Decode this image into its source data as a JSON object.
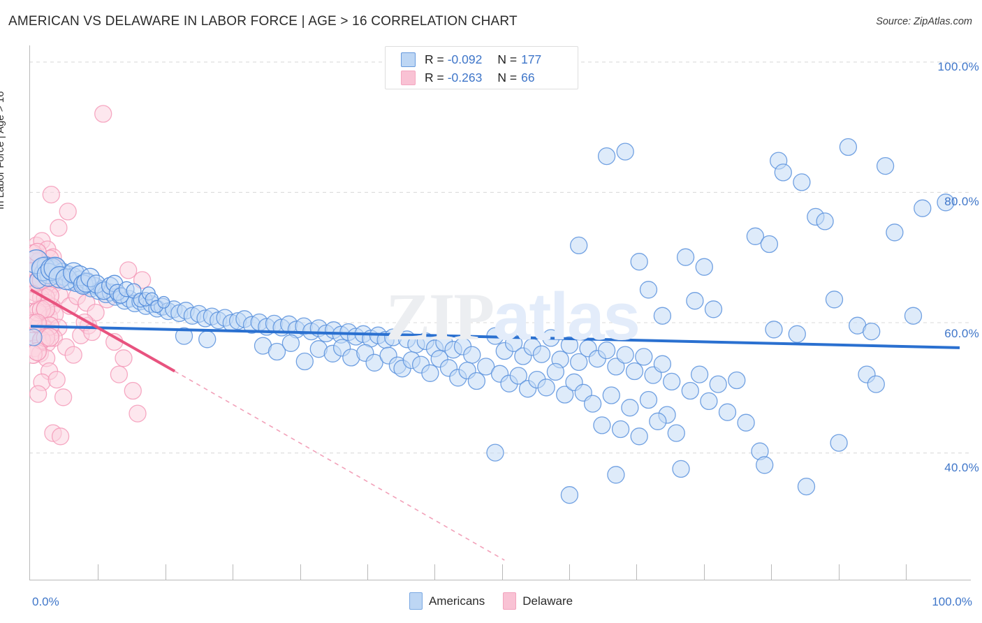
{
  "header": {
    "title": "AMERICAN VS DELAWARE IN LABOR FORCE | AGE > 16 CORRELATION CHART",
    "source": "Source: ZipAtlas.com"
  },
  "watermark": {
    "part1": "ZIP",
    "part2": "atlas"
  },
  "legend_box": {
    "rows": [
      {
        "series": "Americans",
        "r_label": "R =",
        "r_value": "-0.092",
        "n_label": "N =",
        "n_value": "177",
        "color": "#bdd6f4"
      },
      {
        "series": "Delaware",
        "r_label": "R =",
        "r_value": "-0.263",
        "n_label": "N =",
        "n_value": "66",
        "color": "#f9c2d4"
      }
    ]
  },
  "bottom_legend": [
    {
      "label": "Americans",
      "color": "#bdd6f4"
    },
    {
      "label": "Delaware",
      "color": "#f9c2d4"
    }
  ],
  "axes": {
    "y_title": "In Labor Force | Age > 16",
    "y_ticks": [
      "100.0%",
      "80.0%",
      "60.0%",
      "40.0%"
    ],
    "x_min_label": "0.0%",
    "x_max_label": "100.0%"
  },
  "chart_data": {
    "type": "scatter",
    "title": "AMERICAN VS DELAWARE IN LABOR FORCE | AGE > 16 CORRELATION CHART",
    "xlabel": "",
    "ylabel": "In Labor Force | Age > 16",
    "xlim": [
      0,
      100
    ],
    "ylim": [
      20.5,
      102.5
    ],
    "x_tick_values": [
      0,
      100
    ],
    "y_tick_values": [
      40,
      60,
      80,
      100
    ],
    "grid": "horizontal-dashed",
    "legend_position": "top-center",
    "colors": {
      "americans_fill": "#c3daf6",
      "americans_stroke": "#5b92dd",
      "delaware_fill": "#fbd3e0",
      "delaware_stroke": "#f49ab9",
      "trend_americans": "#2a70d0",
      "trend_delaware": "#e8537f"
    },
    "series": [
      {
        "name": "Americans",
        "r": -0.092,
        "n": 177,
        "trendline": {
          "x0": 0,
          "y0": 59.4,
          "x1": 100,
          "y1": 56.1,
          "style": "solid"
        },
        "points": [
          [
            0.3,
            57.7
          ],
          [
            0.8,
            66.5
          ],
          [
            1.0,
            68.4
          ],
          [
            1.3,
            67.6
          ],
          [
            1.6,
            68.8
          ],
          [
            1.9,
            67.2
          ],
          [
            2.2,
            68.3
          ],
          [
            2.5,
            67.5
          ],
          [
            2.8,
            68.6
          ],
          [
            3.1,
            67.0
          ],
          [
            3.4,
            67.8
          ],
          [
            3.7,
            66.9
          ],
          [
            4.0,
            67.4
          ],
          [
            4.3,
            66.2
          ],
          [
            4.6,
            67.1
          ],
          [
            4.9,
            66.0
          ],
          [
            5.3,
            66.6
          ],
          [
            5.7,
            65.8
          ],
          [
            6.1,
            66.3
          ],
          [
            6.5,
            65.2
          ],
          [
            6.9,
            65.6
          ],
          [
            7.3,
            64.8
          ],
          [
            7.7,
            65.1
          ],
          [
            8.1,
            64.3
          ],
          [
            8.6,
            64.6
          ],
          [
            9.1,
            63.9
          ],
          [
            9.6,
            64.1
          ],
          [
            10.1,
            63.3
          ],
          [
            10.6,
            63.6
          ],
          [
            11.2,
            62.9
          ],
          [
            11.8,
            63.2
          ],
          [
            12.4,
            62.5
          ],
          [
            13.0,
            62.8
          ],
          [
            13.6,
            62.1
          ],
          [
            14.2,
            62.4
          ],
          [
            14.8,
            61.7
          ],
          [
            15.4,
            62.0
          ],
          [
            16.0,
            61.4
          ],
          [
            16.7,
            61.8
          ],
          [
            17.4,
            61.0
          ],
          [
            18.1,
            61.3
          ],
          [
            18.8,
            60.6
          ],
          [
            19.5,
            60.9
          ],
          [
            20.2,
            60.3
          ],
          [
            20.9,
            60.7
          ],
          [
            21.6,
            59.9
          ],
          [
            22.3,
            60.2
          ],
          [
            16.5,
            57.9
          ],
          [
            19.0,
            57.4
          ],
          [
            23.0,
            60.5
          ],
          [
            23.8,
            59.6
          ],
          [
            24.6,
            60.0
          ],
          [
            25.4,
            59.3
          ],
          [
            26.2,
            59.8
          ],
          [
            27.0,
            59.2
          ],
          [
            27.8,
            59.7
          ],
          [
            28.6,
            58.9
          ],
          [
            29.4,
            59.4
          ],
          [
            30.2,
            58.6
          ],
          [
            31.0,
            59.1
          ],
          [
            31.8,
            58.3
          ],
          [
            32.6,
            58.8
          ],
          [
            33.4,
            58.1
          ],
          [
            34.2,
            58.5
          ],
          [
            35.0,
            57.8
          ],
          [
            35.8,
            58.2
          ],
          [
            36.6,
            57.5
          ],
          [
            37.4,
            58.0
          ],
          [
            38.2,
            57.3
          ],
          [
            39.0,
            57.7
          ],
          [
            25.0,
            56.4
          ],
          [
            26.5,
            55.5
          ],
          [
            28.0,
            56.8
          ],
          [
            29.5,
            54.0
          ],
          [
            31.0,
            55.9
          ],
          [
            32.5,
            55.2
          ],
          [
            33.5,
            56.1
          ],
          [
            34.5,
            54.6
          ],
          [
            36.0,
            55.3
          ],
          [
            37.0,
            53.8
          ],
          [
            38.5,
            54.9
          ],
          [
            39.5,
            53.4
          ],
          [
            40.5,
            57.4
          ],
          [
            41.5,
            56.6
          ],
          [
            42.5,
            57.1
          ],
          [
            43.5,
            56.0
          ],
          [
            44.5,
            56.9
          ],
          [
            45.5,
            55.8
          ],
          [
            46.5,
            56.3
          ],
          [
            47.5,
            55.0
          ],
          [
            40.0,
            52.9
          ],
          [
            41.0,
            54.2
          ],
          [
            42.0,
            53.5
          ],
          [
            43.0,
            52.2
          ],
          [
            44.0,
            54.4
          ],
          [
            45.0,
            53.0
          ],
          [
            46.0,
            51.5
          ],
          [
            47.0,
            52.6
          ],
          [
            48.0,
            51.0
          ],
          [
            49.0,
            53.2
          ],
          [
            50.0,
            57.9
          ],
          [
            51.0,
            55.6
          ],
          [
            52.0,
            56.8
          ],
          [
            53.0,
            54.8
          ],
          [
            54.0,
            56.2
          ],
          [
            55.0,
            55.1
          ],
          [
            56.0,
            57.6
          ],
          [
            57.0,
            54.3
          ],
          [
            58.0,
            56.5
          ],
          [
            59.0,
            53.9
          ],
          [
            50.5,
            52.1
          ],
          [
            51.5,
            50.6
          ],
          [
            52.5,
            51.8
          ],
          [
            53.5,
            49.8
          ],
          [
            54.5,
            51.2
          ],
          [
            55.5,
            50.0
          ],
          [
            56.5,
            52.4
          ],
          [
            57.5,
            48.9
          ],
          [
            58.5,
            50.8
          ],
          [
            59.5,
            49.2
          ],
          [
            60.0,
            56.0
          ],
          [
            61.0,
            54.4
          ],
          [
            62.0,
            55.7
          ],
          [
            63.0,
            53.2
          ],
          [
            64.0,
            55.0
          ],
          [
            65.0,
            52.5
          ],
          [
            66.0,
            54.7
          ],
          [
            67.0,
            51.9
          ],
          [
            68.0,
            53.6
          ],
          [
            69.0,
            50.9
          ],
          [
            60.5,
            47.5
          ],
          [
            62.5,
            48.8
          ],
          [
            64.5,
            46.9
          ],
          [
            66.5,
            48.1
          ],
          [
            68.5,
            45.8
          ],
          [
            61.5,
            44.2
          ],
          [
            63.5,
            43.6
          ],
          [
            65.5,
            42.5
          ],
          [
            67.5,
            44.8
          ],
          [
            69.5,
            43.0
          ],
          [
            58.0,
            33.5
          ],
          [
            63.0,
            36.6
          ],
          [
            70.0,
            37.5
          ],
          [
            71.0,
            49.5
          ],
          [
            72.0,
            52.0
          ],
          [
            73.0,
            47.9
          ],
          [
            74.0,
            50.5
          ],
          [
            75.0,
            46.2
          ],
          [
            76.0,
            51.1
          ],
          [
            77.0,
            44.6
          ],
          [
            59.0,
            71.8
          ],
          [
            62.0,
            85.5
          ],
          [
            64.0,
            86.2
          ],
          [
            65.5,
            69.3
          ],
          [
            70.5,
            70.0
          ],
          [
            72.5,
            68.5
          ],
          [
            71.5,
            63.3
          ],
          [
            66.5,
            65.0
          ],
          [
            68.0,
            61.0
          ],
          [
            73.5,
            62.0
          ],
          [
            78.0,
            73.2
          ],
          [
            79.5,
            72.0
          ],
          [
            80.5,
            84.8
          ],
          [
            81.0,
            83.0
          ],
          [
            83.0,
            81.5
          ],
          [
            84.5,
            76.2
          ],
          [
            85.5,
            75.5
          ],
          [
            88.0,
            86.9
          ],
          [
            92.0,
            84.0
          ],
          [
            96.0,
            77.5
          ],
          [
            98.5,
            78.4
          ],
          [
            95.0,
            61.0
          ],
          [
            86.5,
            63.5
          ],
          [
            89.0,
            59.5
          ],
          [
            90.5,
            58.6
          ],
          [
            82.5,
            58.2
          ],
          [
            80.0,
            58.9
          ],
          [
            87.0,
            41.5
          ],
          [
            78.5,
            40.2
          ],
          [
            83.5,
            34.8
          ],
          [
            79.0,
            38.1
          ],
          [
            90.0,
            52.0
          ],
          [
            91.0,
            50.5
          ],
          [
            93.0,
            73.8
          ],
          [
            50.0,
            40.0
          ]
        ]
      },
      {
        "name": "Delaware",
        "r": -0.263,
        "n": 66,
        "trendline": {
          "x0": 0,
          "y0": 65.0,
          "x1": 15.5,
          "y1": 52.5,
          "style": "solid"
        },
        "trendline_extension": {
          "x0": 15.5,
          "y0": 52.5,
          "x1": 51.0,
          "y1": 23.5,
          "style": "dashed"
        },
        "points": [
          [
            7.8,
            92.0
          ],
          [
            2.2,
            79.6
          ],
          [
            4.0,
            77.0
          ],
          [
            0.6,
            71.8
          ],
          [
            1.2,
            72.5
          ],
          [
            1.8,
            71.2
          ],
          [
            2.4,
            70.0
          ],
          [
            0.9,
            69.5
          ],
          [
            1.5,
            68.9
          ],
          [
            2.1,
            69.8
          ],
          [
            0.4,
            68.0
          ],
          [
            1.0,
            67.3
          ],
          [
            1.6,
            66.8
          ],
          [
            2.8,
            68.4
          ],
          [
            3.4,
            67.0
          ],
          [
            0.7,
            66.0
          ],
          [
            1.3,
            65.5
          ],
          [
            1.9,
            64.8
          ],
          [
            2.5,
            65.9
          ],
          [
            3.1,
            64.2
          ],
          [
            0.5,
            64.5
          ],
          [
            1.1,
            63.8
          ],
          [
            1.7,
            63.0
          ],
          [
            2.3,
            62.4
          ],
          [
            0.8,
            62.0
          ],
          [
            1.4,
            61.5
          ],
          [
            2.0,
            60.8
          ],
          [
            2.6,
            61.2
          ],
          [
            0.3,
            60.2
          ],
          [
            0.9,
            59.6
          ],
          [
            1.5,
            59.0
          ],
          [
            2.2,
            58.4
          ],
          [
            3.0,
            59.2
          ],
          [
            0.6,
            58.0
          ],
          [
            1.2,
            57.4
          ],
          [
            1.8,
            56.8
          ],
          [
            2.5,
            57.6
          ],
          [
            0.4,
            56.0
          ],
          [
            1.0,
            55.2
          ],
          [
            1.7,
            54.5
          ],
          [
            3.8,
            56.2
          ],
          [
            4.6,
            55.0
          ],
          [
            5.4,
            58.0
          ],
          [
            6.2,
            59.5
          ],
          [
            4.2,
            62.5
          ],
          [
            5.0,
            64.0
          ],
          [
            6.0,
            63.0
          ],
          [
            7.0,
            61.5
          ],
          [
            8.2,
            63.5
          ],
          [
            10.5,
            68.0
          ],
          [
            12.0,
            66.5
          ],
          [
            9.0,
            57.0
          ],
          [
            10.0,
            54.5
          ],
          [
            9.5,
            52.0
          ],
          [
            11.0,
            49.5
          ],
          [
            2.0,
            52.5
          ],
          [
            1.2,
            50.8
          ],
          [
            2.8,
            51.2
          ],
          [
            0.8,
            49.0
          ],
          [
            3.5,
            48.5
          ],
          [
            2.4,
            43.0
          ],
          [
            3.2,
            42.5
          ],
          [
            11.5,
            46.0
          ],
          [
            3.0,
            74.5
          ],
          [
            5.8,
            60.0
          ],
          [
            6.6,
            58.5
          ]
        ]
      }
    ]
  }
}
